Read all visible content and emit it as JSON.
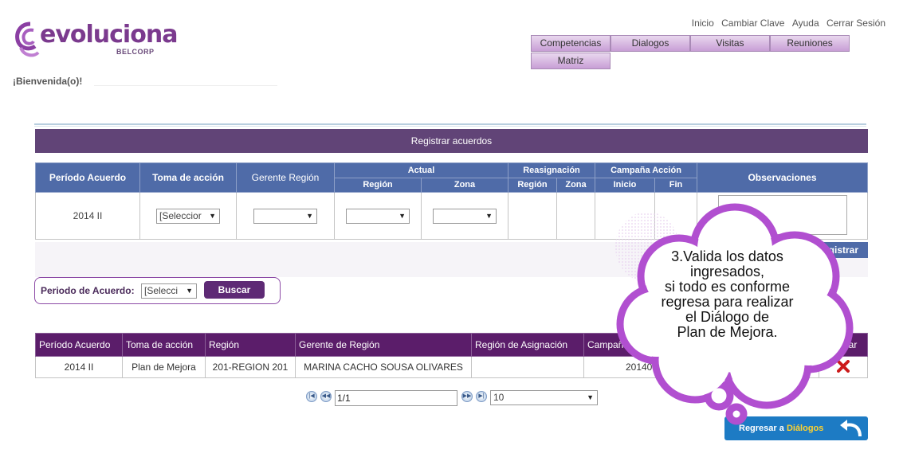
{
  "brand": {
    "name": "evoluciona",
    "sub": "BELCORP"
  },
  "top_links": [
    "Inicio",
    "Cambiar Clave",
    "Ayuda",
    "Cerrar Sesión"
  ],
  "menu": [
    "Competencias",
    "Dialogos",
    "Visitas",
    "Reuniones",
    "Matriz"
  ],
  "welcome": "¡Bienvenida(o)!",
  "section_title": "Registrar acuerdos",
  "acuerdos_table": {
    "headers": {
      "periodo": "Período Acuerdo",
      "toma": "Toma de acción",
      "gerente": "Gerente Región",
      "actual": "Actual",
      "reasignacion": "Reasignación",
      "campana": "Campaña Acción",
      "observaciones": "Observaciones",
      "region": "Región",
      "zona": "Zona",
      "inicio": "Inicio",
      "fin": "Fin"
    },
    "row": {
      "periodo": "2014 II",
      "toma_value": "[Seleccior",
      "gerente_value": "",
      "region_value": "",
      "zona_value": ""
    }
  },
  "register_button": "Registrar",
  "filter": {
    "label": "Periodo de Acuerdo:",
    "value": "[Selecci",
    "button": "Buscar"
  },
  "results_table": {
    "headers": [
      "Período Acuerdo",
      "Toma de acción",
      "Región",
      "Gerente de Región",
      "Región de Asignación",
      "Campaña",
      "",
      "Eliminar"
    ],
    "rows": [
      {
        "periodo": "2014 II",
        "toma": "Plan de Mejora",
        "region": "201-REGION 201",
        "gerente": "MARINA CACHO SOUSA OLIVARES",
        "asignacion": "",
        "campana": "201400",
        "extra": "s"
      }
    ]
  },
  "pager": {
    "page": "1/1",
    "size": "10"
  },
  "back_button": {
    "prefix": "Regresar a ",
    "highlight": "Diálogos"
  },
  "callout": "3.Valida los datos\ningresados,\nsi todo es conforme\nregresa para realizar\nel Diálogo de\nPlan de Mejora.",
  "colors": {
    "purple_header": "#614477",
    "blue_header": "#4f6ba8",
    "dark_purple": "#5b1d6a",
    "callout_stroke": "#b14fd0",
    "button_blue": "#1d7bc4"
  }
}
